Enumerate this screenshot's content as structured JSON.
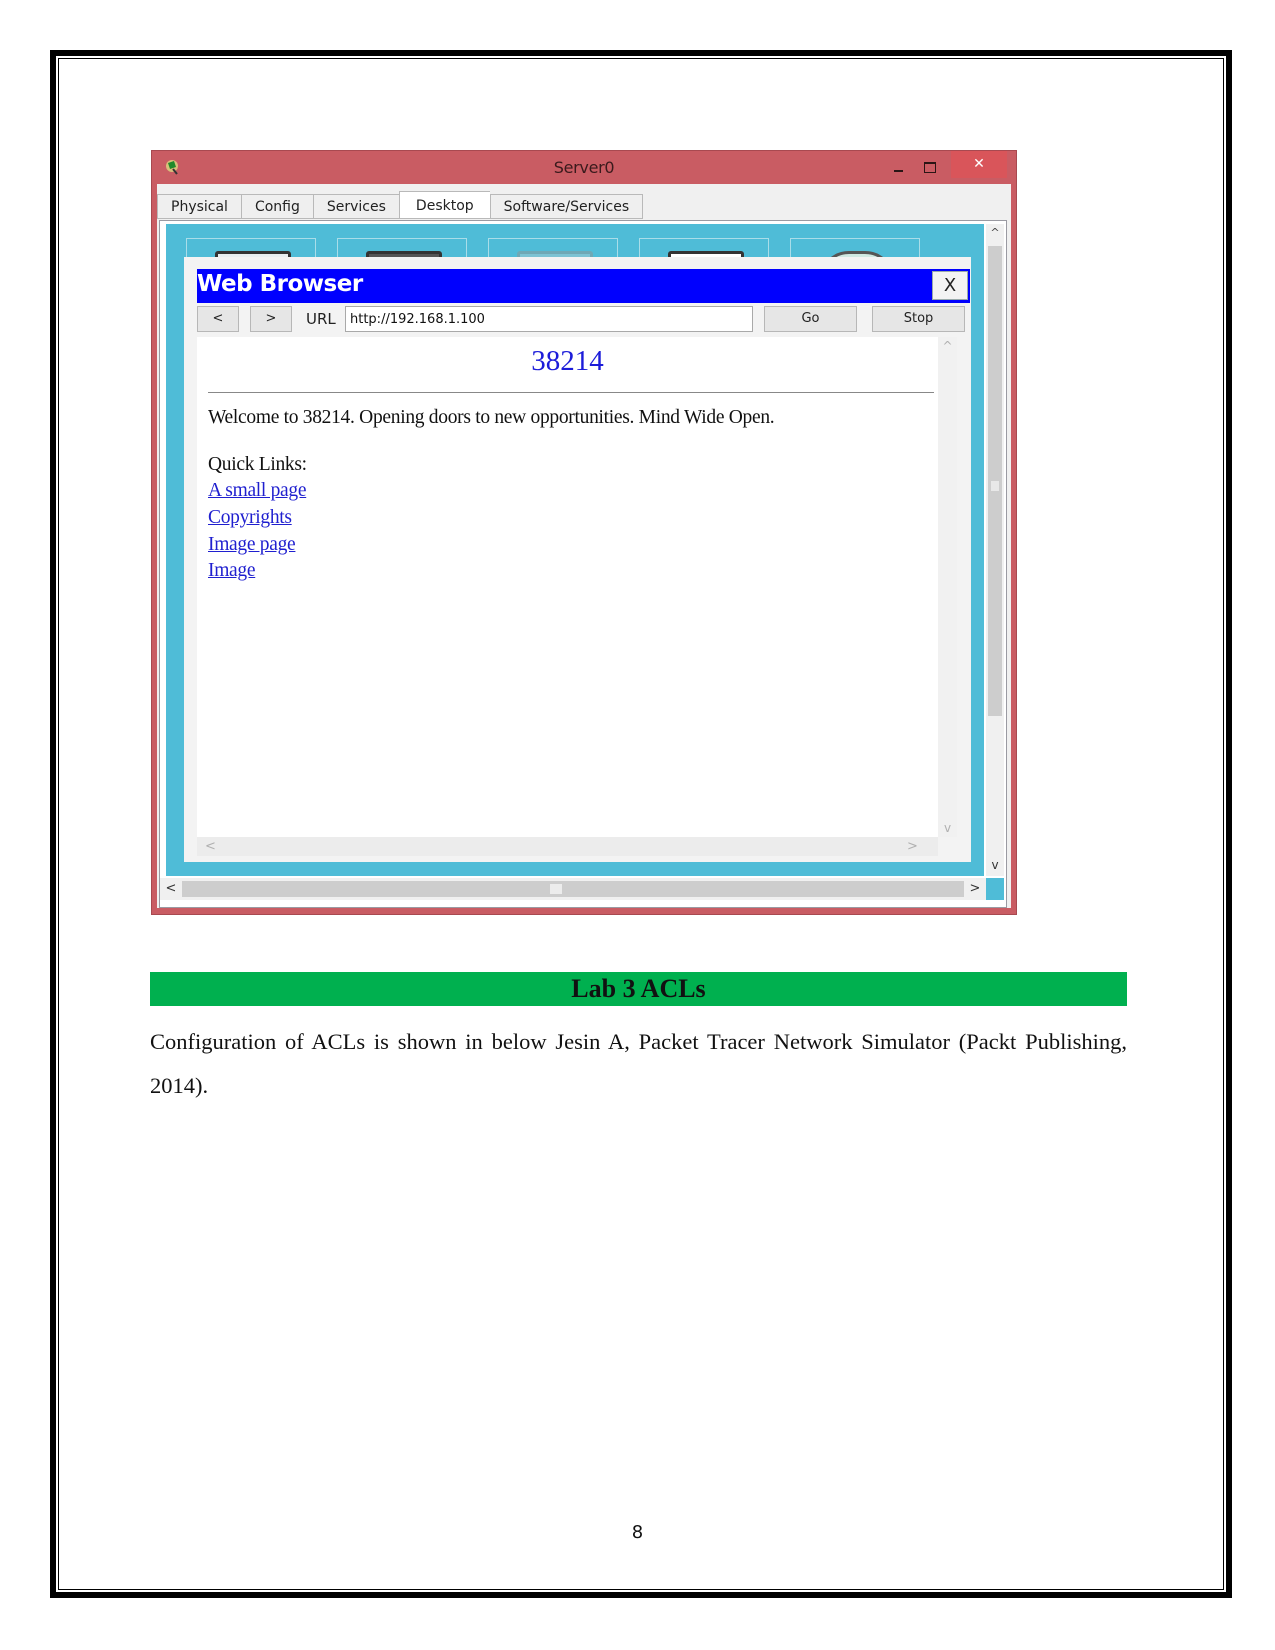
{
  "screenshot": {
    "window": {
      "title": "Server0",
      "app_icon": "packet-tracer-icon",
      "controls": {
        "minimize": "minimize-icon",
        "maximize": "maximize-icon",
        "close": "✕"
      },
      "tabs": [
        {
          "label": "Physical",
          "active": false
        },
        {
          "label": "Config",
          "active": false
        },
        {
          "label": "Services",
          "active": false
        },
        {
          "label": "Desktop",
          "active": true
        },
        {
          "label": "Software/Services",
          "active": false
        }
      ],
      "desktop_icons": [
        "ip-configuration-icon",
        "terminal-icon",
        "command-prompt-icon",
        "web-browser-icon",
        "pc-wireless-icon"
      ],
      "scrollbars": {
        "up": "^",
        "down": "v",
        "left": "<",
        "right": ">"
      }
    },
    "web_browser": {
      "title": "Web Browser",
      "close_label": "X",
      "back_label": "<",
      "forward_label": ">",
      "url_label": "URL",
      "url_value": "http://192.168.1.100",
      "go_label": "Go",
      "stop_label": "Stop",
      "page": {
        "heading": "38214",
        "welcome": "Welcome to 38214. Opening doors to new opportunities. Mind Wide Open.",
        "quick_links_label": "Quick Links:",
        "links": [
          "A small page",
          "Copyrights",
          "Image page",
          "Image"
        ]
      },
      "scrollbars": {
        "up": "^",
        "down": "v",
        "left": "<",
        "right": ">"
      }
    }
  },
  "document": {
    "section_title": "Lab 3 ACLs",
    "paragraph": "Configuration of ACLs is shown in below Jesin A, Packet Tracer Network Simulator (Packt Publishing, 2014).",
    "page_number": "8",
    "section_bar_color": "#00b04f"
  }
}
